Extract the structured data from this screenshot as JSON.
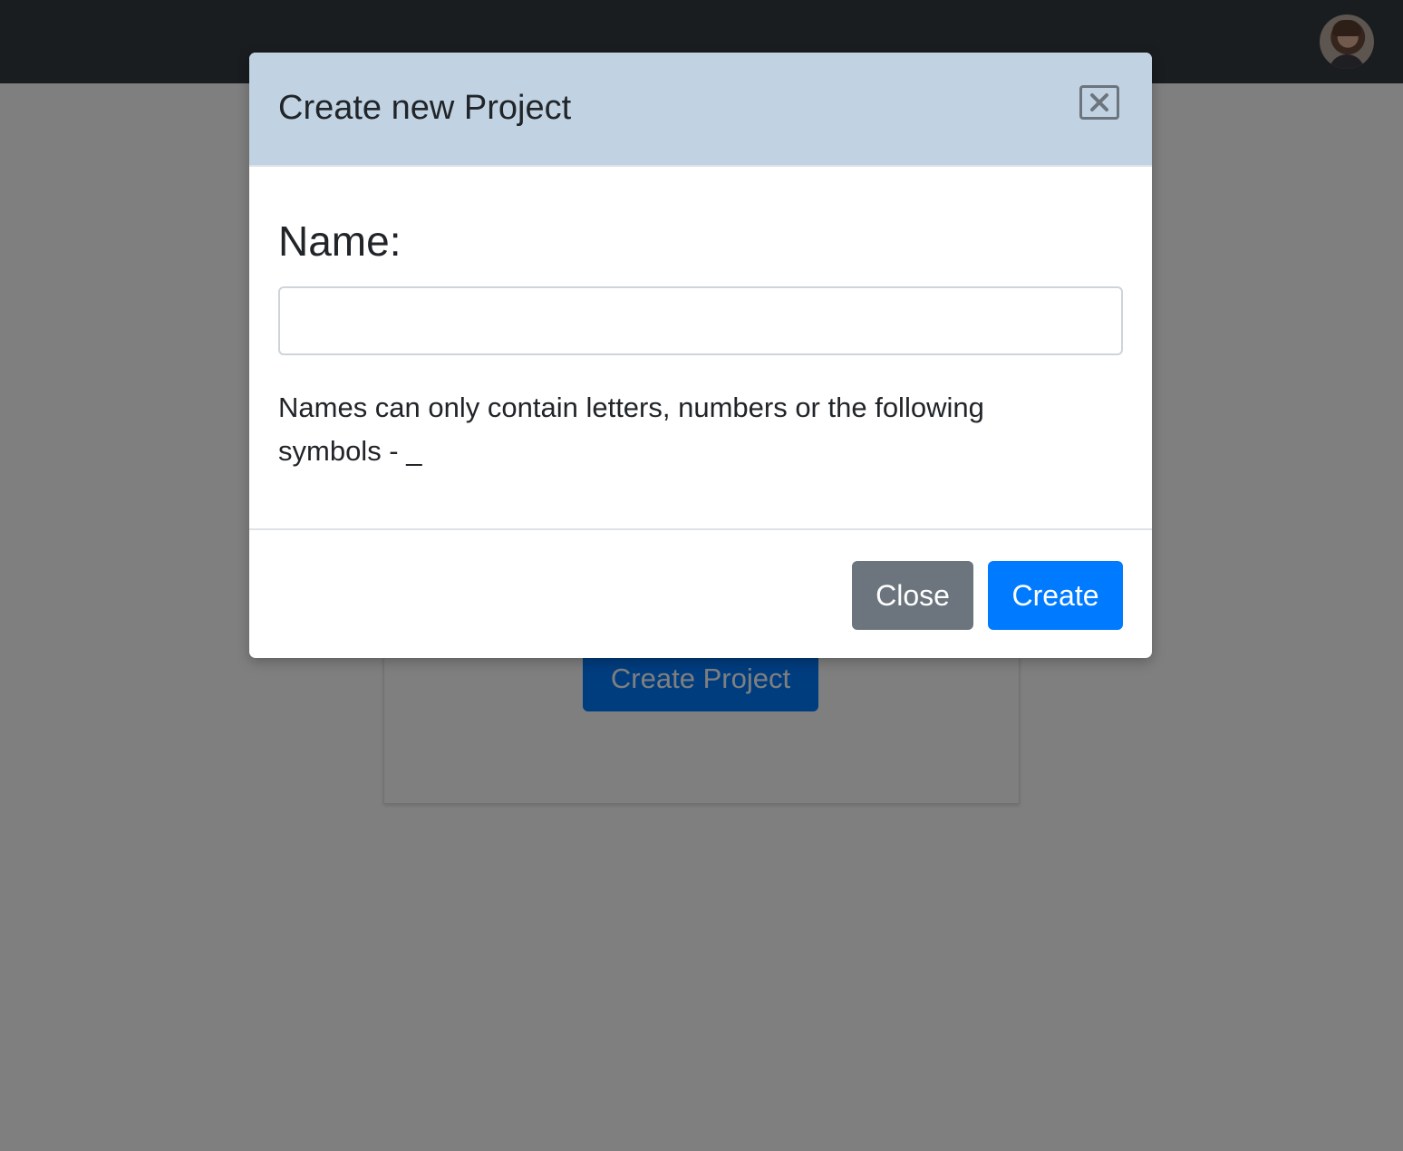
{
  "navbar": {
    "avatar_icon": "user-avatar"
  },
  "page": {
    "create_project_button": "Create Project"
  },
  "modal": {
    "title": "Create new Project",
    "close_icon": "close-icon",
    "name_label": "Name:",
    "name_value": "",
    "help_text": "Names can only contain letters, numbers or the following symbols - _",
    "close_button": "Close",
    "create_button": "Create"
  },
  "colors": {
    "navbar": "#343a40",
    "modal_header": "#c1d3e3",
    "primary": "#007bff",
    "secondary": "#6c757d"
  }
}
